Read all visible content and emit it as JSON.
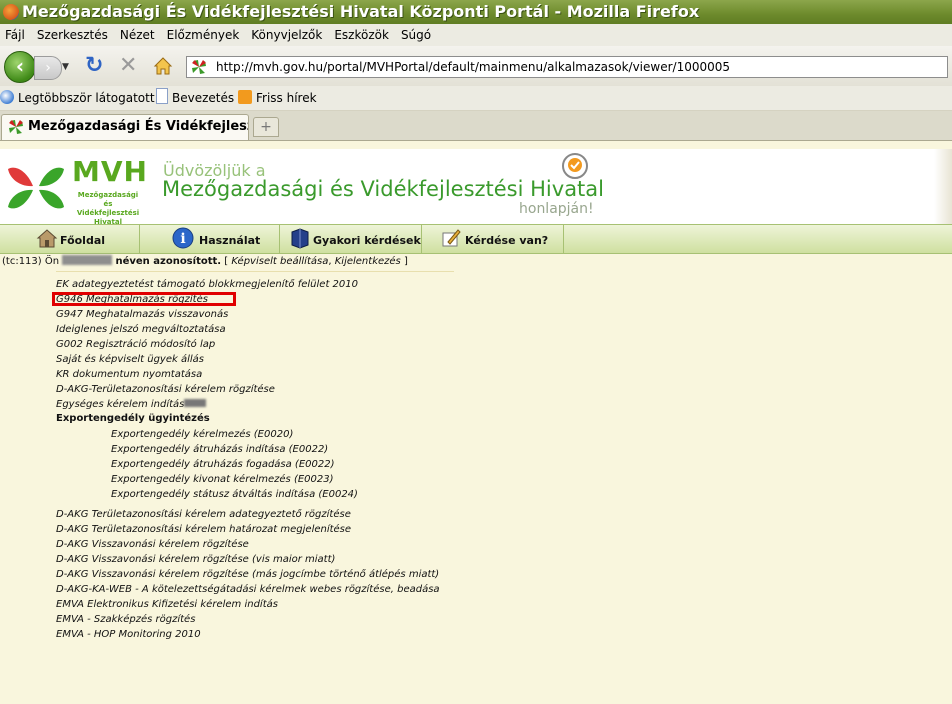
{
  "window": {
    "title": "Mezőgazdasági És Vidékfejlesztési Hivatal Központi Portál - Mozilla Firefox"
  },
  "menu": [
    "Fájl",
    "Szerkesztés",
    "Nézet",
    "Előzmények",
    "Könyvjelzők",
    "Eszközök",
    "Súgó"
  ],
  "address": {
    "url": "http://mvh.gov.hu/portal/MVHPortal/default/mainmenu/alkalmazasok/viewer/1000005"
  },
  "bookmarks": [
    "Legtöbbször látogatott",
    "Bevezetés",
    "Friss hírek"
  ],
  "tab": {
    "label": "Mezőgazdasági És Vidékfejleszt...",
    "new_tab": "+"
  },
  "banner": {
    "logo_text": "MVH",
    "logo_sub": "Mezőgazdasági és Vidékfejlesztési Hivatal",
    "welcome_line1": "Üdvözöljük a",
    "welcome_line2": "Mezőgazdasági és Vidékfejlesztési Hivatal",
    "welcome_line3": "honlapján!"
  },
  "nav": [
    "Főoldal",
    "Használat",
    "Gyakori kérdések",
    "Kérdése van?"
  ],
  "login": {
    "prefix": "(tc:113) Ön",
    "suffix": "néven azonosított.",
    "links_open": "[",
    "link1": "Képviselt beállítása",
    "sep": ",",
    "link2": "Kijelentkezés",
    "links_close": "]"
  },
  "apps": [
    "EK adategyeztetést támogató blokkmegjelenítő felület 2010",
    "G946 Meghatalmazás rögzítés",
    "G947 Meghatalmazás visszavonás",
    "Ideiglenes jelszó megváltoztatása",
    "G002 Regisztráció módosító lap",
    "Saját és képviselt ügyek állás",
    "KR dokumentum nyomtatása",
    "D-AKG-Területazonosítási kérelem rögzítése",
    "Egységes kérelem indítás"
  ],
  "export_heading": "Exportengedély ügyintézés",
  "export_items": [
    "Exportengedély kérelmezés (E0020)",
    "Exportengedély átruházás indítása (E0022)",
    "Exportengedély átruházás fogadása (E0022)",
    "Exportengedély kivonat kérelmezés (E0023)",
    "Exportengedély státusz átváltás indítása (E0024)"
  ],
  "apps2": [
    "D-AKG Területazonosítási kérelem adategyeztető rögzítése",
    "D-AKG Területazonosítási kérelem határozat megjelenítése",
    "D-AKG Visszavonási kérelem rögzítése",
    "D-AKG Visszavonási kérelem rögzítése (vis maior miatt)",
    "D-AKG Visszavonási kérelem rögzítése (más jogcímbe történő átlépés miatt)",
    "D-AKG-KA-WEB - A kötelezettségátadási kérelmek webes rögzítése, beadása",
    "EMVA Elektronikus Kifizetési kérelem indítás",
    "EMVA - Szakképzés rögzítés",
    "EMVA - HOP Monitoring 2010"
  ],
  "highlight_color": "#e00000",
  "brand_green": "#59a81f"
}
